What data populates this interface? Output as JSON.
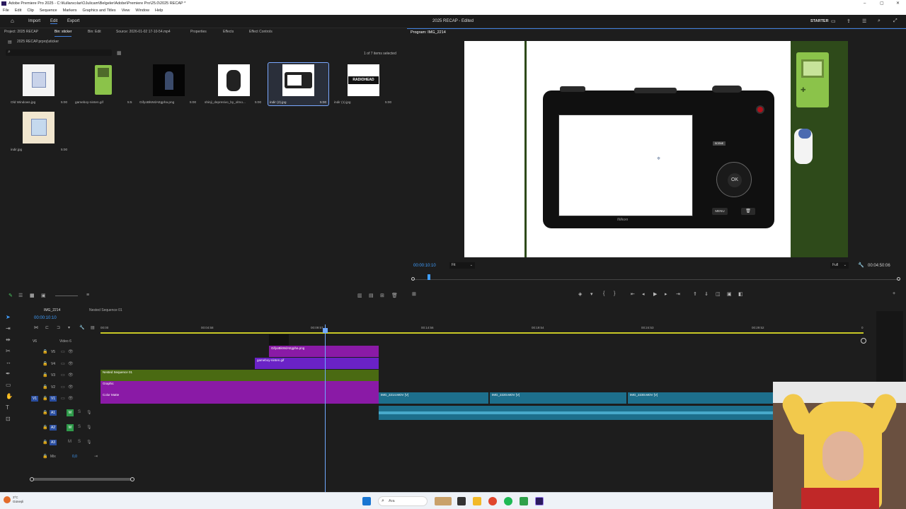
{
  "window": {
    "title": "Adobe Premiere Pro 2025 - C:\\Kullanıcılar\\OJulicam\\Belgeler\\Adobe\\Premiere Pro\\25.0\\2025 RECAP *"
  },
  "menu": [
    "File",
    "Edit",
    "Clip",
    "Sequence",
    "Markers",
    "Graphics and Titles",
    "View",
    "Window",
    "Help"
  ],
  "appbar": {
    "workspaces": [
      "Import",
      "Edit",
      "Export"
    ],
    "active_workspace": "Edit",
    "doc_title": "2025 RECAP - Edited",
    "badge": "STARTER"
  },
  "project_panel": {
    "tabs": [
      "Project: 2025 RECAP",
      "Bin: sticker",
      "Bin: Edit",
      "Source: 2026-01-02 17-10-54.mp4",
      "Properties",
      "Effects",
      "Effect Controls"
    ],
    "active_tab": "Bin: sticker",
    "path": "2025 RECAP.prproj\\sticker",
    "count": "1 of 7 items selected",
    "items": [
      {
        "name": "Old Windows.jpg",
        "duration": "5:00"
      },
      {
        "name": "gameboy-ninten.gif",
        "duration": "5:5"
      },
      {
        "name": "GifyoBkWdAEgpha.png",
        "duration": "5:00"
      },
      {
        "name": "shinji_depresivo_by_olmo...",
        "duration": "5:00"
      },
      {
        "name": "indir (2).jpg",
        "duration": "5:00"
      },
      {
        "name": "indir (1).jpg",
        "duration": "5:00"
      },
      {
        "name": "indir.jpg",
        "duration": "5:00"
      }
    ],
    "radiohead_label": "RADIOHEAD"
  },
  "program_monitor": {
    "tab": "Program: IMG_2214",
    "timecode": "00:00:10:10",
    "fit": "Fit",
    "resolution": "Full",
    "duration": "00:04:50:06",
    "camera": {
      "brand": "Nikon",
      "ok": "OK",
      "menu": "MENU",
      "scene": "SCENE"
    }
  },
  "timeline": {
    "tabs": [
      "IMG_2214",
      "Nested Sequence 01"
    ],
    "timecode": "00:00:10:10",
    "ruler_labels": [
      "00:00",
      "00:04:58",
      "00:09:57",
      "00:14:56",
      "00:19:54",
      "00:24:53",
      "00:29:52",
      "0"
    ],
    "tracks": [
      {
        "id": "V6",
        "name": "Video 6"
      },
      {
        "id": "V5",
        "name": ""
      },
      {
        "id": "V4",
        "name": ""
      },
      {
        "id": "V3",
        "name": ""
      },
      {
        "id": "V2",
        "name": ""
      },
      {
        "id": "V1",
        "name": ""
      },
      {
        "id": "A1",
        "name": ""
      },
      {
        "id": "A2",
        "name": ""
      },
      {
        "id": "A3",
        "name": ""
      },
      {
        "id": "Mix",
        "name": "Mix",
        "value": "0,0"
      }
    ],
    "clips": {
      "gify": "GifyoBkWdAEgpha.png",
      "gameboy": "gameboy-ninten.gif",
      "nested": "Nested Sequence 01",
      "graphic": "Graphic",
      "color_matte": "Color Matte",
      "img2214": "IMG_2214.MOV [V]",
      "img2220": "IMG_2220.MOV [V]",
      "img2230": "IMG_2230.MOV [V]"
    }
  },
  "taskbar": {
    "weather_temp": "3°C",
    "weather_text": "Güneşli",
    "search_placeholder": "Ara"
  },
  "colors": {
    "accent": "#3f9eff",
    "clip_magenta": "#8a1aa6",
    "clip_olive": "#4a6a12",
    "clip_teal": "#1d6f8c",
    "gameboy_green": "#2e4a1a"
  }
}
